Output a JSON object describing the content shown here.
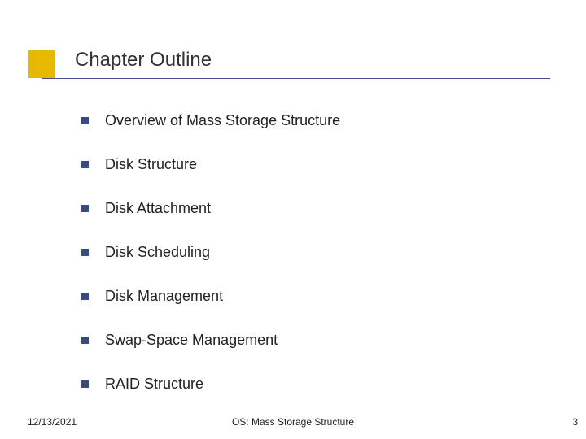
{
  "title": "Chapter Outline",
  "bullets": [
    "Overview of Mass Storage Structure",
    "Disk Structure",
    "Disk Attachment",
    "Disk Scheduling",
    "Disk Management",
    "Swap-Space Management",
    "RAID Structure"
  ],
  "footer": {
    "date": "12/13/2021",
    "center": "OS: Mass Storage Structure",
    "page": "3"
  }
}
